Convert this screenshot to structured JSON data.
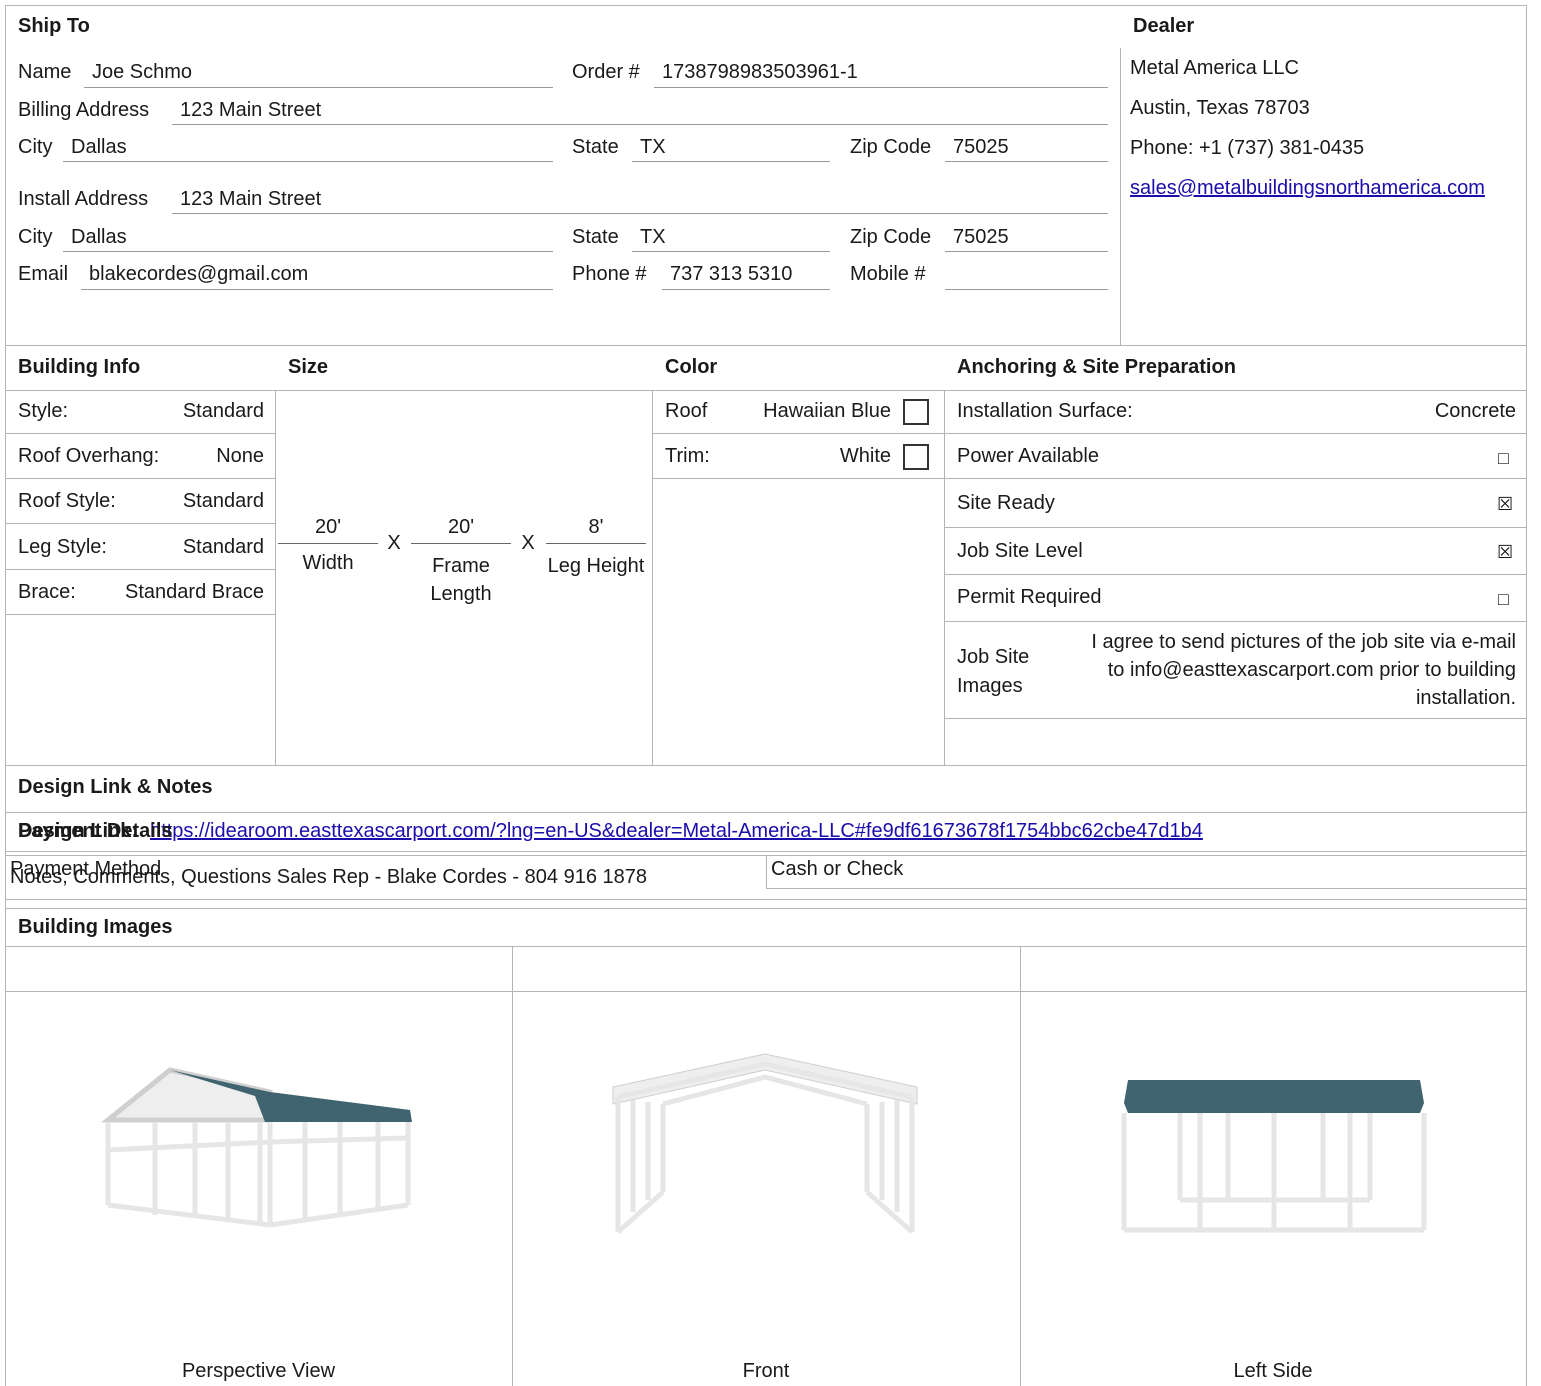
{
  "ship_to": {
    "heading": "Ship To",
    "name_label": "Name",
    "name": "Joe Schmo",
    "order_label": "Order #",
    "order": "1738798983503961-1",
    "billing_label": "Billing Address",
    "billing": "123 Main Street",
    "city_label": "City",
    "city": "Dallas",
    "state_label": "State",
    "state": "TX",
    "zip_label": "Zip Code",
    "zip": "75025",
    "install_label": "Install Address",
    "install": "123 Main Street",
    "city2": "Dallas",
    "state2": "TX",
    "zip2": "75025",
    "email_label": "Email",
    "email": "blakecordes@gmail.com",
    "phone_label": "Phone #",
    "phone": "737 313 5310",
    "mobile_label": "Mobile #",
    "mobile": ""
  },
  "dealer": {
    "heading": "Dealer",
    "name": "Metal America LLC",
    "location": "Austin, Texas 78703",
    "phone": "Phone: +1 (737) 381-0435",
    "email": "sales@metalbuildingsnorthamerica.com"
  },
  "building_info": {
    "heading": "Building Info",
    "rows": [
      {
        "label": "Style:",
        "value": "Standard"
      },
      {
        "label": "Roof Overhang:",
        "value": "None"
      },
      {
        "label": "Roof Style:",
        "value": "Standard"
      },
      {
        "label": "Leg Style:",
        "value": "Standard"
      },
      {
        "label": "Brace:",
        "value": "Standard Brace"
      }
    ]
  },
  "size": {
    "heading": "Size",
    "width": "20'",
    "width_label": "Width",
    "length": "20'",
    "length_label": "Frame Length",
    "height": "8'",
    "height_label": "Leg Height",
    "times": "X"
  },
  "color": {
    "heading": "Color",
    "roof_label": "Roof",
    "roof": "Hawaiian Blue",
    "roof_hex": "#ffffff",
    "trim_label": "Trim:",
    "trim": "White",
    "trim_hex": "#ffffff"
  },
  "anchoring": {
    "heading": "Anchoring & Site Preparation",
    "surface_label": "Installation Surface:",
    "surface": "Concrete",
    "rows": [
      {
        "label": "Power Available",
        "checked": false,
        "mark": "□"
      },
      {
        "label": "Site Ready",
        "checked": true,
        "mark": "☒"
      },
      {
        "label": "Job Site Level",
        "checked": true,
        "mark": "☒"
      },
      {
        "label": "Permit Required",
        "checked": false,
        "mark": "□"
      }
    ],
    "images_label": "Job Site Images",
    "images_text": "I agree to send pictures of the job site via e-mail to info@easttexascarport.com prior to building installation."
  },
  "design": {
    "heading": "Design Link & Notes",
    "link_label": "Design Link:",
    "link": "https://idearoom.easttexascarport.com/?lng=en-US&dealer=Metal-America-LLC#fe9df61673678f1754bbc62cbe47d1b4",
    "notes": "Notes, Comments, Questions Sales Rep - Blake Cordes - 804 916 1878"
  },
  "payment": {
    "heading": "Payment Details",
    "method_label": "Payment Method",
    "method": "Cash or Check"
  },
  "images": {
    "heading": "Building Images",
    "roof_color": "#3f6470",
    "frame_color": "#e6e6e6",
    "views": [
      {
        "caption": "Perspective View"
      },
      {
        "caption": "Front"
      },
      {
        "caption": "Left Side"
      }
    ]
  }
}
